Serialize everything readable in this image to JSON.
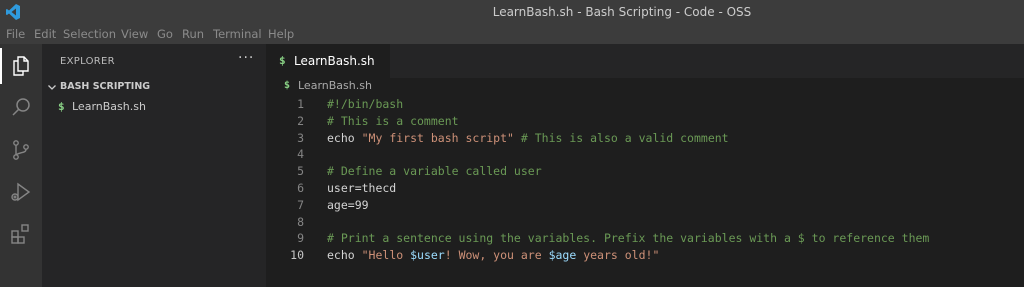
{
  "window": {
    "title": "LearnBash.sh - Bash Scripting - Code - OSS"
  },
  "menu": [
    "File",
    "Edit",
    "Selection",
    "View",
    "Go",
    "Run",
    "Terminal",
    "Help"
  ],
  "activity_bar": [
    "explorer-icon",
    "search-icon",
    "source-control-icon",
    "run-debug-icon",
    "extensions-icon"
  ],
  "sidebar": {
    "title": "EXPLORER",
    "more": "···",
    "section": "BASH SCRIPTING",
    "files": [
      {
        "icon": "$",
        "name": "LearnBash.sh"
      }
    ]
  },
  "tab": {
    "icon": "$",
    "label": "LearnBash.sh"
  },
  "breadcrumb": {
    "icon": "$",
    "label": "LearnBash.sh"
  },
  "editor": {
    "active_line": 10,
    "lines": [
      {
        "n": "1",
        "code": "#!/bin/bash"
      },
      {
        "n": "2",
        "code": "# This is a comment"
      },
      {
        "n": "3",
        "code": "echo \"My first bash script\" # This is also a valid comment"
      },
      {
        "n": "4",
        "code": ""
      },
      {
        "n": "5",
        "code": "# Define a variable called user"
      },
      {
        "n": "6",
        "code": "user=thecd"
      },
      {
        "n": "7",
        "code": "age=99"
      },
      {
        "n": "8",
        "code": ""
      },
      {
        "n": "9",
        "code": "# Print a sentence using the variables. Prefix the variables with a $ to reference them"
      },
      {
        "n": "10",
        "code": "echo \"Hello $user! Wow, you are $age years old!\""
      }
    ]
  },
  "colors": {
    "comment": "#6a9955",
    "string": "#ce9178",
    "variable": "#9cdcfe",
    "file_icon": "#89d185"
  }
}
